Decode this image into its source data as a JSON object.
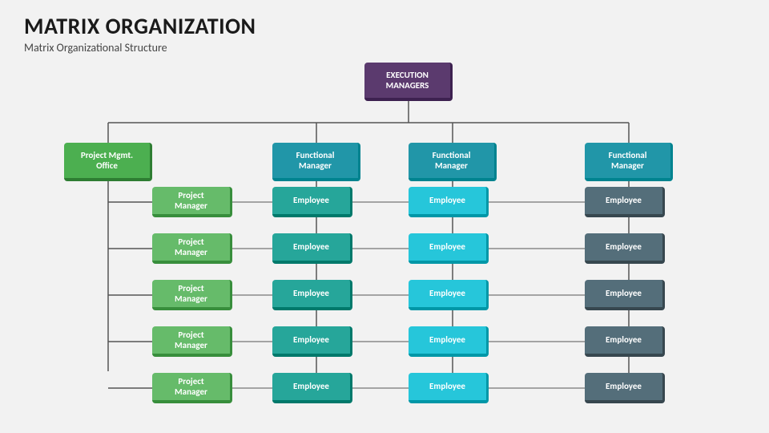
{
  "header": {
    "title": "MATRIX ORGANIZATION",
    "subtitle": "Matrix Organizational Structure"
  },
  "boxes": {
    "exec": {
      "label": "EXECUTION\nMANAGERS"
    },
    "pmo": {
      "label": "Project Mgmt.\nOffice"
    },
    "func1": {
      "label": "Functional\nManager"
    },
    "func2": {
      "label": "Functional\nManager"
    },
    "func3": {
      "label": "Functional\nManager"
    },
    "pm_label": "Project\nManager",
    "emp_label": "Employee"
  }
}
